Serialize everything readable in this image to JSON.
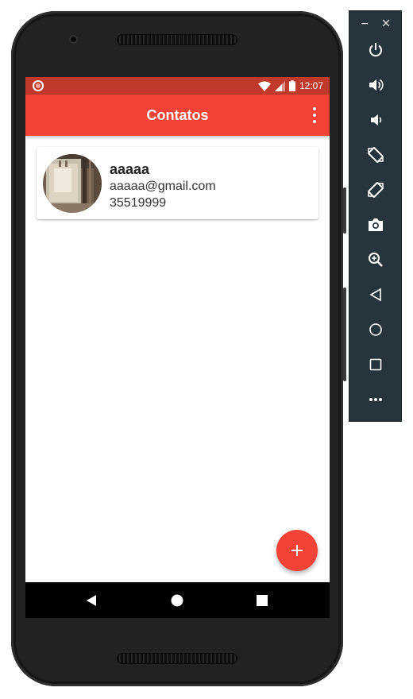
{
  "status_bar": {
    "time": "12:07",
    "icons": [
      "notification-dot-icon",
      "wifi-icon",
      "signal-icon",
      "battery-icon"
    ]
  },
  "app_bar": {
    "title": "Contatos",
    "menu_icon": "more-vert-icon"
  },
  "contacts": [
    {
      "name": "aaaaa",
      "email": "aaaaa@gmail.com",
      "phone": "35519999",
      "avatar": "contact-photo"
    }
  ],
  "fab": {
    "label": "+",
    "icon": "add-icon"
  },
  "nav_bar": {
    "buttons": [
      "back-icon",
      "home-icon",
      "recents-icon"
    ]
  },
  "emulator_toolbar": {
    "window_buttons": [
      "minimize-icon",
      "close-icon"
    ],
    "buttons": [
      "power-icon",
      "volume-up-icon",
      "volume-down-icon",
      "rotate-left-icon",
      "rotate-right-icon",
      "camera-icon",
      "zoom-icon",
      "back-icon",
      "home-icon",
      "overview-icon",
      "more-icon"
    ]
  },
  "colors": {
    "primary": "#f44336",
    "primary_dark": "#c0392b",
    "toolbar_bg": "#26343b"
  }
}
